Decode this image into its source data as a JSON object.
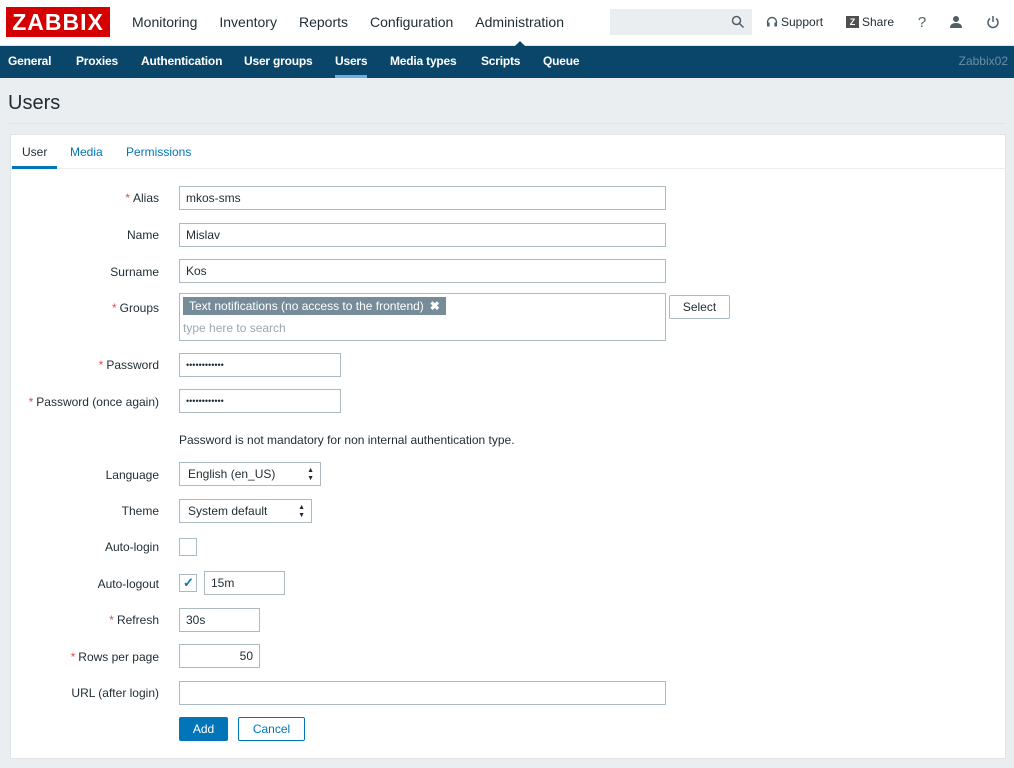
{
  "brand": {
    "logo": "ZABBIX",
    "color": "#d40000"
  },
  "main_menu": [
    {
      "label": "Monitoring",
      "active": false
    },
    {
      "label": "Inventory",
      "active": false
    },
    {
      "label": "Reports",
      "active": false
    },
    {
      "label": "Configuration",
      "active": false
    },
    {
      "label": "Administration",
      "active": true
    }
  ],
  "header": {
    "search_placeholder": "",
    "support_label": "Support",
    "share_label": "Share",
    "share_badge": "Z",
    "help_label": "?"
  },
  "sub_menu": [
    {
      "label": "General",
      "active": false
    },
    {
      "label": "Proxies",
      "active": false
    },
    {
      "label": "Authentication",
      "active": false
    },
    {
      "label": "User groups",
      "active": false
    },
    {
      "label": "Users",
      "active": true
    },
    {
      "label": "Media types",
      "active": false
    },
    {
      "label": "Scripts",
      "active": false
    },
    {
      "label": "Queue",
      "active": false
    }
  ],
  "server_name": "Zabbix02",
  "page_title": "Users",
  "tabs": [
    {
      "label": "User",
      "active": true
    },
    {
      "label": "Media",
      "active": false
    },
    {
      "label": "Permissions",
      "active": false
    }
  ],
  "form": {
    "required_mark": "*",
    "alias": {
      "label": "Alias",
      "value": "mkos-sms",
      "required": true
    },
    "name": {
      "label": "Name",
      "value": "Mislav",
      "required": false
    },
    "surname": {
      "label": "Surname",
      "value": "Kos",
      "required": false
    },
    "groups": {
      "label": "Groups",
      "required": true,
      "selected": "Text notifications (no access to the frontend)",
      "remove_glyph": "✖",
      "placeholder": "type here to search",
      "select_button": "Select"
    },
    "password": {
      "label": "Password",
      "value": "••••••••••••",
      "required": true
    },
    "password_again": {
      "label": "Password (once again)",
      "value": "••••••••••••",
      "required": true
    },
    "password_hint": "Password is not mandatory for non internal authentication type.",
    "language": {
      "label": "Language",
      "value": "English (en_US)"
    },
    "theme": {
      "label": "Theme",
      "value": "System default"
    },
    "auto_login": {
      "label": "Auto-login",
      "checked": false
    },
    "auto_logout": {
      "label": "Auto-logout",
      "checked": true,
      "value": "15m"
    },
    "refresh": {
      "label": "Refresh",
      "value": "30s",
      "required": true
    },
    "rows_per_page": {
      "label": "Rows per page",
      "value": "50",
      "required": true
    },
    "url": {
      "label": "URL (after login)",
      "value": ""
    },
    "add_button": "Add",
    "cancel_button": "Cancel"
  },
  "colors": {
    "nav_bg": "#0a466a",
    "accent": "#0275b8",
    "required": "#e54b4b",
    "page_bg": "#ebeef0"
  }
}
